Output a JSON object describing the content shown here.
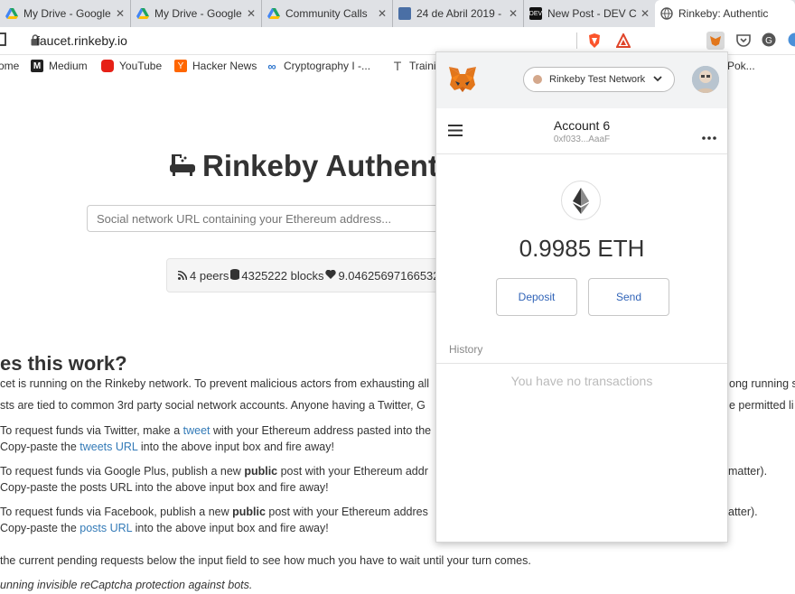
{
  "tabs": [
    {
      "title": "My Drive - Google"
    },
    {
      "title": "My Drive - Google"
    },
    {
      "title": "Community Calls"
    },
    {
      "title": "24 de Abril 2019 -"
    },
    {
      "title": "New Post - DEV C"
    },
    {
      "title": "Rinkeby: Authentic"
    }
  ],
  "address": {
    "url": "faucet.rinkeby.io"
  },
  "bookmarks": [
    {
      "label": "ome"
    },
    {
      "label": "Medium"
    },
    {
      "label": "YouTube"
    },
    {
      "label": "Hacker News"
    },
    {
      "label": "Cryptography I -..."
    },
    {
      "label": "Traini"
    },
    {
      "label": "Pok..."
    }
  ],
  "page": {
    "title": "Rinkeby Authenti",
    "search_placeholder": "Social network URL containing your Ethereum address...",
    "peers": "4 peers",
    "blocks": "4325222 blocks",
    "funds": "9.04625697166532",
    "heading": "es this work?",
    "para1_line1": "cet is running on the Rinkeby network. To prevent malicious actors from exhausting all",
    "para1_line1_tail": "ong running s",
    "para1_line2": "sts are tied to common 3rd party social network accounts. Anyone having a Twitter, G",
    "para1_line2_tail": "e permitted li",
    "tw1_pre": "To request funds via Twitter, make a ",
    "tw1_link": "tweet",
    "tw1_post": " with your Ethereum address pasted into the",
    "tw2_pre": "Copy-paste the ",
    "tw2_link": "tweets URL",
    "tw2_post": " into the above input box and fire away!",
    "gp1_pre": "To request funds via Google Plus, publish a new ",
    "gp1_bold": "public",
    "gp1_post": " post with your Ethereum addr",
    "gp1_tail": "matter).",
    "gp2": "Copy-paste the posts URL into the above input box and fire away!",
    "fb1_pre": "To request funds via Facebook, publish a new ",
    "fb1_bold": "public",
    "fb1_post": " post with your Ethereum addres",
    "fb1_tail": "atter).",
    "fb2_pre": "Copy-paste the ",
    "fb2_link": "posts URL",
    "fb2_post": " into the above input box and fire away!",
    "pending": "the current pending requests below the input field to see how much you have to wait until your turn comes.",
    "recaptcha": "unning invisible reCaptcha protection against bots."
  },
  "metamask": {
    "network": "Rinkeby Test Network",
    "account_name": "Account 6",
    "account_address": "0xf033...AaaF",
    "balance": "0.9985 ETH",
    "deposit_label": "Deposit",
    "send_label": "Send",
    "history_label": "History",
    "no_transactions": "You have no transactions"
  }
}
